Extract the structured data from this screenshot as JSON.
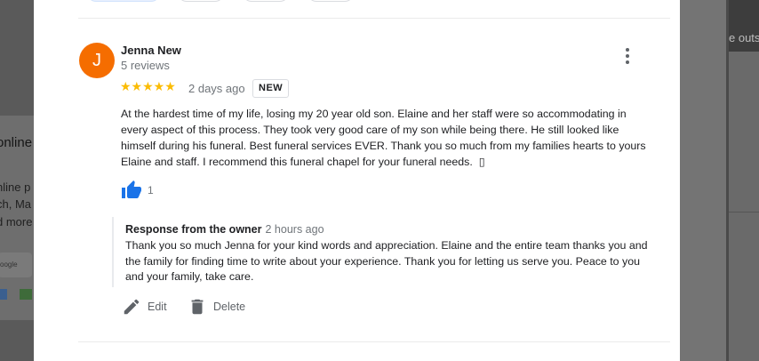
{
  "review": {
    "avatar_letter": "J",
    "author": "Jenna New",
    "reviews_count": "5 reviews",
    "stars": "★★★★★",
    "rating": 5,
    "date": "2 days ago",
    "badge": "NEW",
    "text": "At the hardest time of my life, losing my 20 year old son. Elaine and her staff were so accommodating in every aspect of this process. They took very good care of my son while being there. He still looked like himself during his funeral. Best funeral services EVER. Thank you so much from my families hearts to yours Elaine and staff. I recommend this funeral chapel for your funeral needs.   ▯",
    "likes": "1"
  },
  "owner_response": {
    "title": "Response from the owner",
    "time": "2 hours ago",
    "text": "Thank you so much Jenna for your kind words and appreciation. Elaine and the entire team thanks you and the family for finding time to write about your experience. Thank you for letting us serve you. Peace to you and your family, take care."
  },
  "actions": {
    "edit_label": "Edit",
    "delete_label": "Delete"
  },
  "background": {
    "left_texts": [
      "online",
      "nline p",
      "ch, Ma",
      "d more",
      "oogle"
    ],
    "right_text": "e outs"
  },
  "colors": {
    "avatar": "#f56d00",
    "star": "#fbbc04",
    "like": "#1a73e8"
  }
}
